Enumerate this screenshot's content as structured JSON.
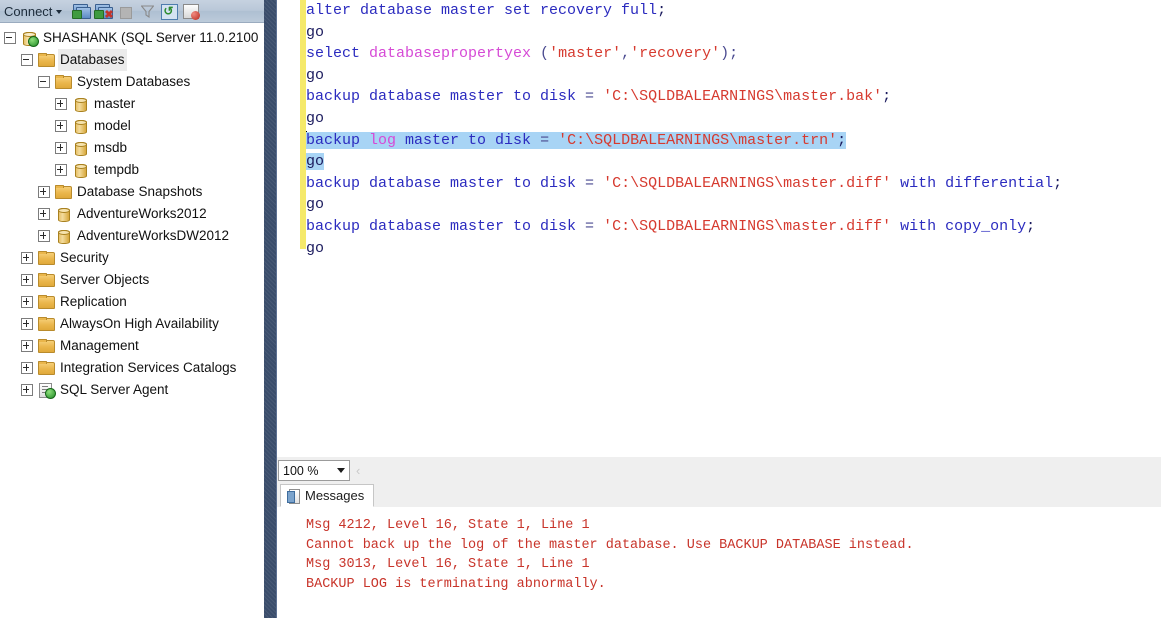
{
  "explorer": {
    "toolbar": {
      "connect_label": "Connect",
      "icons": [
        "connect-object-explorer-icon",
        "disconnect-object-explorer-icon",
        "stop-icon",
        "filter-icon",
        "refresh-icon",
        "script-error-icon"
      ]
    },
    "tree": [
      {
        "label": "SHASHANK (SQL Server 11.0.2100",
        "icon": "server-icon",
        "indent": 0,
        "state": "expanded",
        "selected": false
      },
      {
        "label": "Databases",
        "icon": "folder-icon",
        "indent": 1,
        "state": "expanded",
        "selected": true
      },
      {
        "label": "System Databases",
        "icon": "folder-icon",
        "indent": 2,
        "state": "expanded",
        "selected": false
      },
      {
        "label": "master",
        "icon": "database-icon",
        "indent": 3,
        "state": "collapsed",
        "selected": false
      },
      {
        "label": "model",
        "icon": "database-icon",
        "indent": 3,
        "state": "collapsed",
        "selected": false
      },
      {
        "label": "msdb",
        "icon": "database-icon",
        "indent": 3,
        "state": "collapsed",
        "selected": false
      },
      {
        "label": "tempdb",
        "icon": "database-icon",
        "indent": 3,
        "state": "collapsed",
        "selected": false
      },
      {
        "label": "Database Snapshots",
        "icon": "folder-icon",
        "indent": 2,
        "state": "collapsed",
        "selected": false
      },
      {
        "label": "AdventureWorks2012",
        "icon": "database-icon",
        "indent": 2,
        "state": "collapsed",
        "selected": false
      },
      {
        "label": "AdventureWorksDW2012",
        "icon": "database-icon",
        "indent": 2,
        "state": "collapsed",
        "selected": false
      },
      {
        "label": "Security",
        "icon": "folder-icon",
        "indent": 1,
        "state": "collapsed",
        "selected": false
      },
      {
        "label": "Server Objects",
        "icon": "folder-icon",
        "indent": 1,
        "state": "collapsed",
        "selected": false
      },
      {
        "label": "Replication",
        "icon": "folder-icon",
        "indent": 1,
        "state": "collapsed",
        "selected": false
      },
      {
        "label": "AlwaysOn High Availability",
        "icon": "folder-icon",
        "indent": 1,
        "state": "collapsed",
        "selected": false
      },
      {
        "label": "Management",
        "icon": "folder-icon",
        "indent": 1,
        "state": "collapsed",
        "selected": false
      },
      {
        "label": "Integration Services Catalogs",
        "icon": "folder-icon",
        "indent": 1,
        "state": "collapsed",
        "selected": false
      },
      {
        "label": "SQL Server Agent",
        "icon": "agent-icon",
        "indent": 1,
        "state": "collapsed",
        "selected": false
      }
    ]
  },
  "editor": {
    "selection_color": "#a8d4f5",
    "change_bar_color": "#f5e96a",
    "lines": [
      {
        "id": 1,
        "text": "alter database master set recovery full;",
        "selected": false,
        "tokens": [
          {
            "t": "alter database master set recovery full",
            "c": "kw"
          },
          {
            "t": ";",
            "c": "pl"
          }
        ]
      },
      {
        "id": 2,
        "text": "go",
        "selected": false,
        "tokens": [
          {
            "t": "go",
            "c": "pl"
          }
        ]
      },
      {
        "id": 3,
        "text": "select databasepropertyex ('master','recovery');",
        "selected": false,
        "tokens": [
          {
            "t": "select ",
            "c": "kw"
          },
          {
            "t": "databasepropertyex",
            "c": "fn"
          },
          {
            "t": " (",
            "c": "op"
          },
          {
            "t": "'master'",
            "c": "str"
          },
          {
            "t": ",",
            "c": "op"
          },
          {
            "t": "'recovery'",
            "c": "str"
          },
          {
            "t": ");",
            "c": "op"
          }
        ]
      },
      {
        "id": 4,
        "text": "go",
        "selected": false,
        "tokens": [
          {
            "t": "go",
            "c": "pl"
          }
        ]
      },
      {
        "id": 5,
        "text": "backup database master to disk = 'C:\\SQLDBALEARNINGS\\master.bak';",
        "selected": false,
        "tokens": [
          {
            "t": "backup database master to disk",
            "c": "kw"
          },
          {
            "t": " = ",
            "c": "op"
          },
          {
            "t": "'C:\\SQLDBALEARNINGS\\master.bak'",
            "c": "str"
          },
          {
            "t": ";",
            "c": "pl"
          }
        ]
      },
      {
        "id": 6,
        "text": "go",
        "selected": false,
        "tokens": [
          {
            "t": "go",
            "c": "pl"
          }
        ]
      },
      {
        "id": 7,
        "text": "backup log master to disk = 'C:\\SQLDBALEARNINGS\\master.trn';",
        "selected": true,
        "tokens": [
          {
            "t": "backup ",
            "c": "kw"
          },
          {
            "t": "log",
            "c": "fn"
          },
          {
            "t": " master to disk",
            "c": "kw"
          },
          {
            "t": " = ",
            "c": "op"
          },
          {
            "t": "'C:\\SQLDBALEARNINGS\\master.trn'",
            "c": "str"
          },
          {
            "t": ";",
            "c": "pl"
          }
        ]
      },
      {
        "id": 8,
        "text": "go",
        "selected": true,
        "tokens": [
          {
            "t": "go",
            "c": "pl"
          }
        ]
      },
      {
        "id": 9,
        "text": "backup database master to disk = 'C:\\SQLDBALEARNINGS\\master.diff' with differential;",
        "selected": false,
        "tokens": [
          {
            "t": "backup database master to disk",
            "c": "kw"
          },
          {
            "t": " = ",
            "c": "op"
          },
          {
            "t": "'C:\\SQLDBALEARNINGS\\master.diff'",
            "c": "str"
          },
          {
            "t": " with differential",
            "c": "kw"
          },
          {
            "t": ";",
            "c": "pl"
          }
        ]
      },
      {
        "id": 10,
        "text": "go",
        "selected": false,
        "tokens": [
          {
            "t": "go",
            "c": "pl"
          }
        ]
      },
      {
        "id": 11,
        "text": "backup database master to disk = 'C:\\SQLDBALEARNINGS\\master.diff' with copy_only;",
        "selected": false,
        "tokens": [
          {
            "t": "backup database master to disk",
            "c": "kw"
          },
          {
            "t": " = ",
            "c": "op"
          },
          {
            "t": "'C:\\SQLDBALEARNINGS\\master.diff'",
            "c": "str"
          },
          {
            "t": " with copy_only",
            "c": "kw"
          },
          {
            "t": ";",
            "c": "pl"
          }
        ]
      },
      {
        "id": 12,
        "text": "go",
        "selected": false,
        "tokens": [
          {
            "t": "go",
            "c": "pl"
          }
        ]
      }
    ]
  },
  "results": {
    "zoom_value": "100 %",
    "prev_glyph": "‹",
    "tabs": [
      {
        "label": "Messages",
        "icon": "messages-icon",
        "active": true
      }
    ],
    "messages": [
      "Msg 4212, Level 16, State 1, Line 1",
      "Cannot back up the log of the master database. Use BACKUP DATABASE instead.",
      "Msg 3013, Level 16, State 1, Line 1",
      "BACKUP LOG is terminating abnormally."
    ],
    "message_color": "#c8342a"
  }
}
